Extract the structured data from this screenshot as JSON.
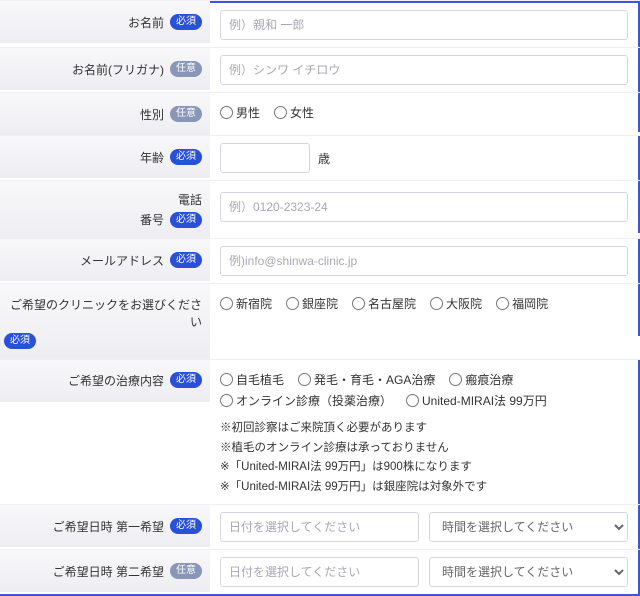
{
  "badges": {
    "required": "必須",
    "optional": "任意"
  },
  "fields": {
    "name": {
      "label": "お名前",
      "placeholder": "例）親和 一郎"
    },
    "furigana": {
      "label": "お名前(フリガナ)",
      "placeholder": "例）シンワ イチロウ"
    },
    "gender": {
      "label": "性別",
      "options": [
        "男性",
        "女性"
      ]
    },
    "age": {
      "label": "年齢",
      "unit": "歳"
    },
    "phone": {
      "label_l1": "電話",
      "label_l2": "番号",
      "placeholder": "例）0120-2323-24"
    },
    "email": {
      "label": "メールアドレス",
      "placeholder": "例)info@shinwa-clinic.jp"
    },
    "clinic": {
      "label": "ご希望のクリニックをお選びください",
      "options": [
        "新宿院",
        "銀座院",
        "名古屋院",
        "大阪院",
        "福岡院"
      ]
    },
    "treatment": {
      "label": "ご希望の治療内容",
      "options": [
        "自毛植毛",
        "発毛・育毛・AGA治療",
        "瘢痕治療",
        "オンライン診療（投薬治療）",
        "United-MIRAI法 99万円"
      ],
      "notes": [
        "※初回診察はご来院頂く必要があります",
        "※植毛のオンライン診療は承っておりません",
        "※「United-MIRAI法 99万円」は900株になります",
        "※「United-MIRAI法 99万円」は銀座院は対象外です"
      ]
    },
    "datetime1": {
      "label": "ご希望日時 第一希望",
      "date_placeholder": "日付を選択してください",
      "time_placeholder": "時間を選択してください"
    },
    "datetime2": {
      "label": "ご希望日時 第二希望",
      "date_placeholder": "日付を選択してください",
      "time_placeholder": "時間を選択してください"
    }
  }
}
